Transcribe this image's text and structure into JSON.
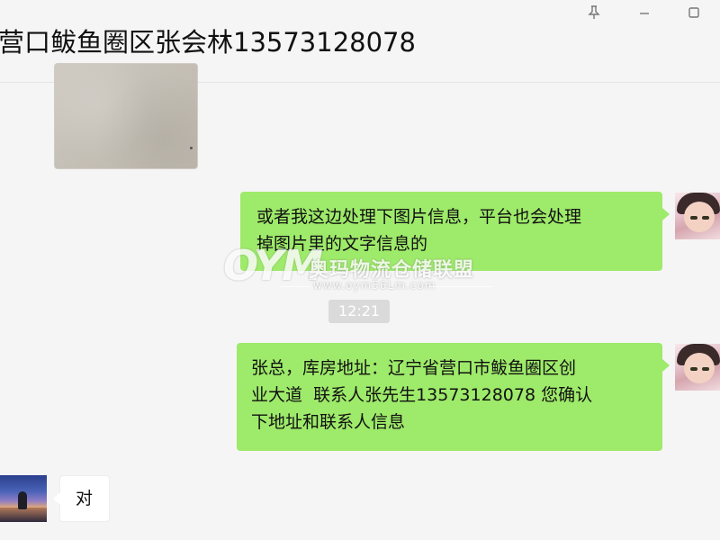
{
  "header": {
    "title": "营口鲅鱼圈区张会林13573128078",
    "icons": [
      "pin-icon",
      "minimize-icon",
      "maximize-icon"
    ]
  },
  "messages": [
    {
      "type": "image",
      "sender": "other"
    },
    {
      "type": "text",
      "sender": "me",
      "lines": [
        "或者我这边处理下图片信息，平台也会处理",
        "掉图片里的文字信息的"
      ]
    },
    {
      "type": "time",
      "text": "12:21"
    },
    {
      "type": "text",
      "sender": "me",
      "lines": [
        "张总，库房地址：辽宁省营口市鲅鱼圈区创",
        "业大道  联系人张先生13573128078 您确认",
        "下地址和联系人信息"
      ]
    },
    {
      "type": "text",
      "sender": "other",
      "lines": [
        "对"
      ]
    }
  ],
  "watermark": {
    "logo": "OYM",
    "name": "奥玛物流仓储联盟",
    "url": "www.oym56Lm.com"
  },
  "colors": {
    "my_bubble": "#9eea6a",
    "other_bubble": "#ffffff",
    "background": "#f5f5f5",
    "timestamp_bg": "#dadada"
  }
}
